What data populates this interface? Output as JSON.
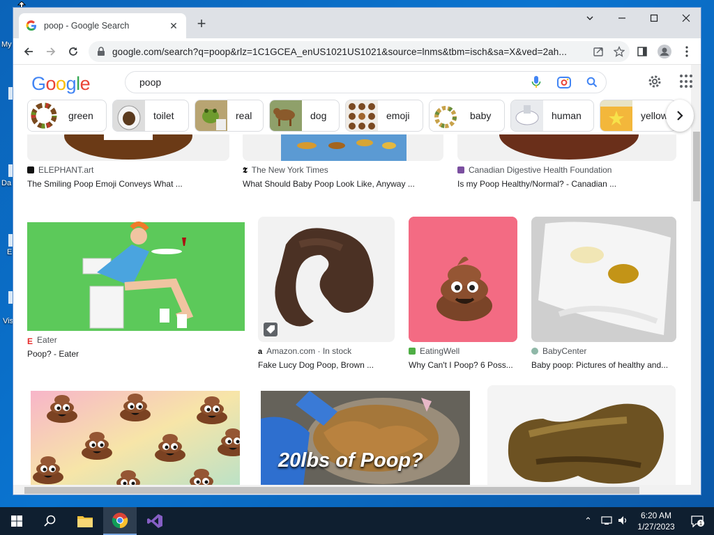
{
  "desktop": {
    "labels": [
      "My",
      "Da",
      "E",
      "Vis"
    ]
  },
  "browser": {
    "tab_title": "poop - Google Search",
    "url": "google.com/search?q=poop&rlz=1C1GCEA_enUS1021US1021&source=lnms&tbm=isch&sa=X&ved=2ah..."
  },
  "google": {
    "logo": "Google",
    "logo_colors": [
      "#4285f4",
      "#ea4335",
      "#fbbc05",
      "#4285f4",
      "#34a853",
      "#ea4335"
    ],
    "query": "poop",
    "chips": [
      {
        "label": "green",
        "icon": "color-wheel-thumb"
      },
      {
        "label": "toilet",
        "icon": "toilet-thumb"
      },
      {
        "label": "real",
        "icon": "frog-thumb"
      },
      {
        "label": "dog",
        "icon": "dog-thumb"
      },
      {
        "label": "emoji",
        "icon": "emoji-thumb"
      },
      {
        "label": "baby",
        "icon": "chart-thumb"
      },
      {
        "label": "human",
        "icon": "toilet-human-thumb"
      },
      {
        "label": "yellow",
        "icon": "yellow-thumb"
      }
    ]
  },
  "results": {
    "row1": [
      {
        "source": "ELEPHANT.art",
        "title": "The Smiling Poop Emoji Conveys What ..."
      },
      {
        "source": "The New York Times",
        "title": "What Should Baby Poop Look Like, Anyway ..."
      },
      {
        "source": "Canadian Digestive Health Foundation",
        "title": "Is my Poop Healthy/Normal? - Canadian ..."
      }
    ],
    "row2": [
      {
        "source": "Eater",
        "title": "Poop? - Eater"
      },
      {
        "source": "Amazon.com · In stock",
        "title": "Fake Lucy Dog Poop, Brown ..."
      },
      {
        "source": "EatingWell",
        "title": "Why Can't I Poop? 6 Poss..."
      },
      {
        "source": "BabyCenter",
        "title": "Baby poop: Pictures of healthy and..."
      }
    ],
    "row3_overlay_text": "20lbs of Poop?"
  },
  "taskbar": {
    "time": "6:20 AM",
    "date": "1/27/2023"
  }
}
